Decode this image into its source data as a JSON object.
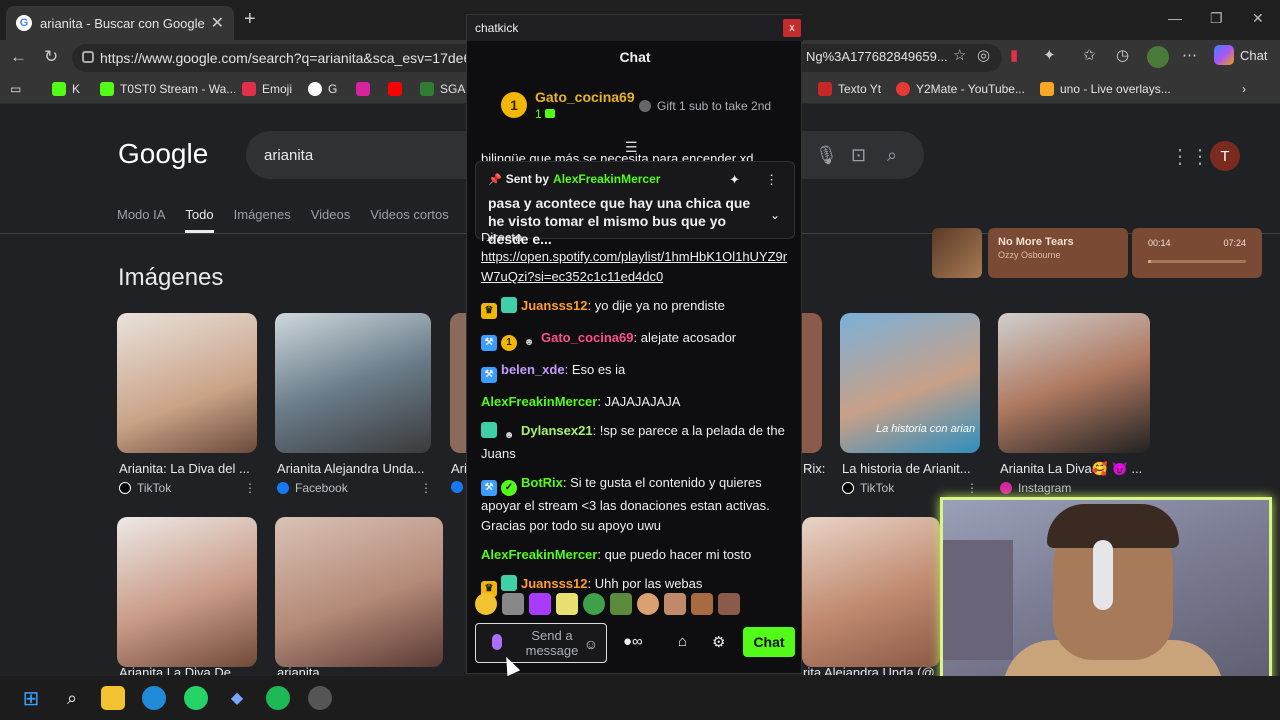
{
  "browser": {
    "tab_title": "arianita - Buscar con Google",
    "url": "https://www.google.com/search?q=arianita&sca_esv=17de63e8",
    "url_tail": "Ng%3A1776828496​59...",
    "copilot_label": "Chat",
    "bookmarks": [
      "K",
      "T0ST0 Stream - Wa...",
      "Emoji",
      "G",
      "SGA",
      "Texto Yt",
      "Y2Mate - YouTube...",
      "uno - Live overlays..."
    ]
  },
  "google": {
    "logo": "Google",
    "query": "arianita",
    "user_initial": "T",
    "tabs": [
      "Modo IA",
      "Todo",
      "Imágenes",
      "Videos",
      "Videos cortos"
    ],
    "section_title": "Imágenes",
    "results": [
      {
        "caption": "Arianita: La Diva del ...",
        "source": "TikTok"
      },
      {
        "caption": "Arianita Alejandra Unda...",
        "source": "Facebook"
      },
      {
        "caption": "Ari",
        "source": ""
      },
      {
        "caption": "Rix:",
        "source": ""
      },
      {
        "caption": "La historia de Arianit...",
        "source": "TikTok"
      },
      {
        "caption": "Arianita La Diva🥰 😈 ...",
        "source": "Instagram"
      }
    ],
    "row2_captions": [
      "Arianita La Diva De",
      "arianita",
      "rita Alejandra Unda (@"
    ],
    "thumb_overlay_text": "La historia con arian"
  },
  "music": {
    "song": "No More Tears",
    "artist": "Ozzy Osbourne",
    "elapsed": "00:14",
    "duration": "07:24",
    "progress": 0.03
  },
  "chatkick": {
    "window_title": "chatkick",
    "close": "x",
    "header": "Chat",
    "gifter": {
      "badge": "1",
      "name": "Gato_cocina69",
      "count": "1"
    },
    "gift_cta": "Gift 1 sub to take 2nd",
    "pinned": {
      "sent_by_label": "Sent by",
      "sent_by_name": "AlexFreakinMercer",
      "message": "pasa y acontece que hay una chica que he visto tomar el mismo bus que yo desde e..."
    },
    "partial_top": "bilingüe que más se necesita para encender xd",
    "partial_directo": "Directo",
    "link": "https://open.spotify.com/playlist/1hmHbK1Ol1hUYZ9rW7uQzi?si=ec352c1c11ed4dc0",
    "messages": [
      {
        "user": "Juansss12",
        "text": ": yo dije ya no prendiste",
        "color": "#ff9d2e"
      },
      {
        "user": "Gato_cocina69",
        "text": ": alejate acosador",
        "color": "#ff4f8b"
      },
      {
        "user": "belen_xde",
        "text": ": Eso es ia",
        "color": "#c39bff"
      },
      {
        "user": "AlexFreakinMercer",
        "text": ": JAJAJAJAJA",
        "color": "#53fc18"
      },
      {
        "user": "Dylansex21",
        "text": ": !sp se parece a la pelada de the Juans",
        "color": "#a7f070"
      },
      {
        "user": "BotRix",
        "text": ": Si te gusta el contenido y quieres apoyar el stream <3 las donaciones estan activas. Gracias por todo su apoyo uwu",
        "color": "#53fc18"
      },
      {
        "user": "AlexFreakinMercer",
        "text": ": que puedo hacer mi tosto",
        "color": "#53fc18"
      },
      {
        "user": "Juansss12",
        "text": ": Uhh por las webas",
        "color": "#ff9d2e"
      }
    ],
    "input_placeholder": "Send a message",
    "chat_button": "Chat"
  },
  "colors": {
    "kick_green": "#53fc18",
    "webcam_border": "#d9f58a"
  }
}
